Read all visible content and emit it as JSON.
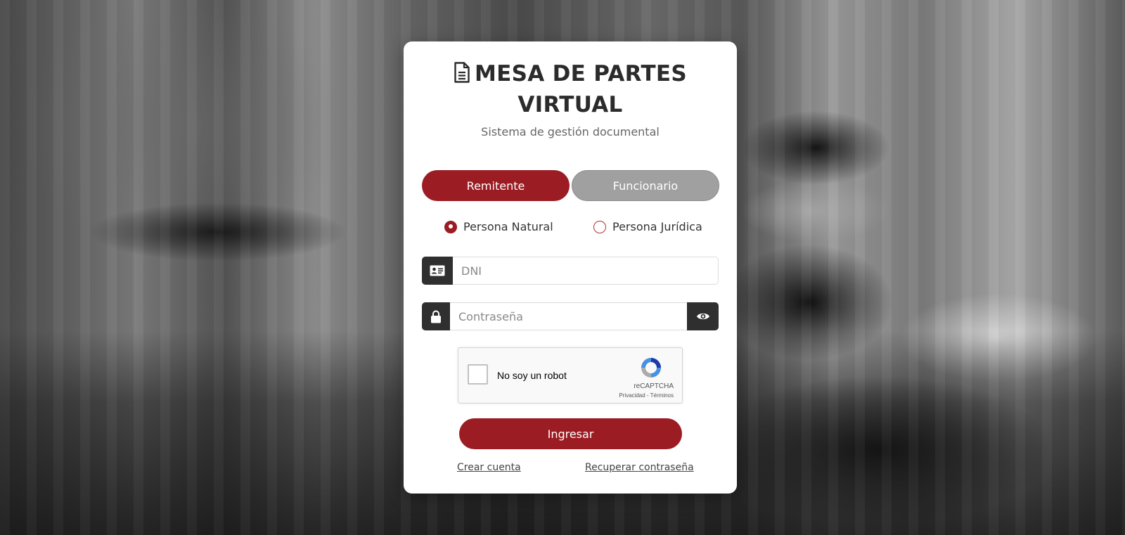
{
  "colors": {
    "primary": "#9b1c23",
    "inactive_tab": "#a0a0a0",
    "addon_dark": "#2f2f2f",
    "card_bg": "#ffffff"
  },
  "header": {
    "icon": "document-icon",
    "title_line1": "MESA DE PARTES",
    "title_line2": "VIRTUAL",
    "subtitle": "Sistema de gestión documental"
  },
  "role_tabs": {
    "active": "Remitente",
    "items": [
      {
        "label": "Remitente",
        "active": true
      },
      {
        "label": "Funcionario",
        "active": false
      }
    ]
  },
  "person_type": {
    "selected": "Persona Natural",
    "options": [
      {
        "label": "Persona Natural",
        "checked": true
      },
      {
        "label": "Persona Jurídica",
        "checked": false
      }
    ]
  },
  "form": {
    "dni": {
      "icon": "id-card-icon",
      "value": "",
      "placeholder": "DNI"
    },
    "password": {
      "icon": "lock-icon",
      "toggle_icon": "eye-icon",
      "value": "",
      "placeholder": "Contraseña"
    }
  },
  "captcha": {
    "label": "No soy un robot",
    "checked": false,
    "brand": "reCAPTCHA",
    "privacy": "Privacidad",
    "separator": " - ",
    "terms": "Términos"
  },
  "submit_label": "Ingresar",
  "links": {
    "create_account": "Crear cuenta",
    "recover_password": "Recuperar contraseña"
  }
}
